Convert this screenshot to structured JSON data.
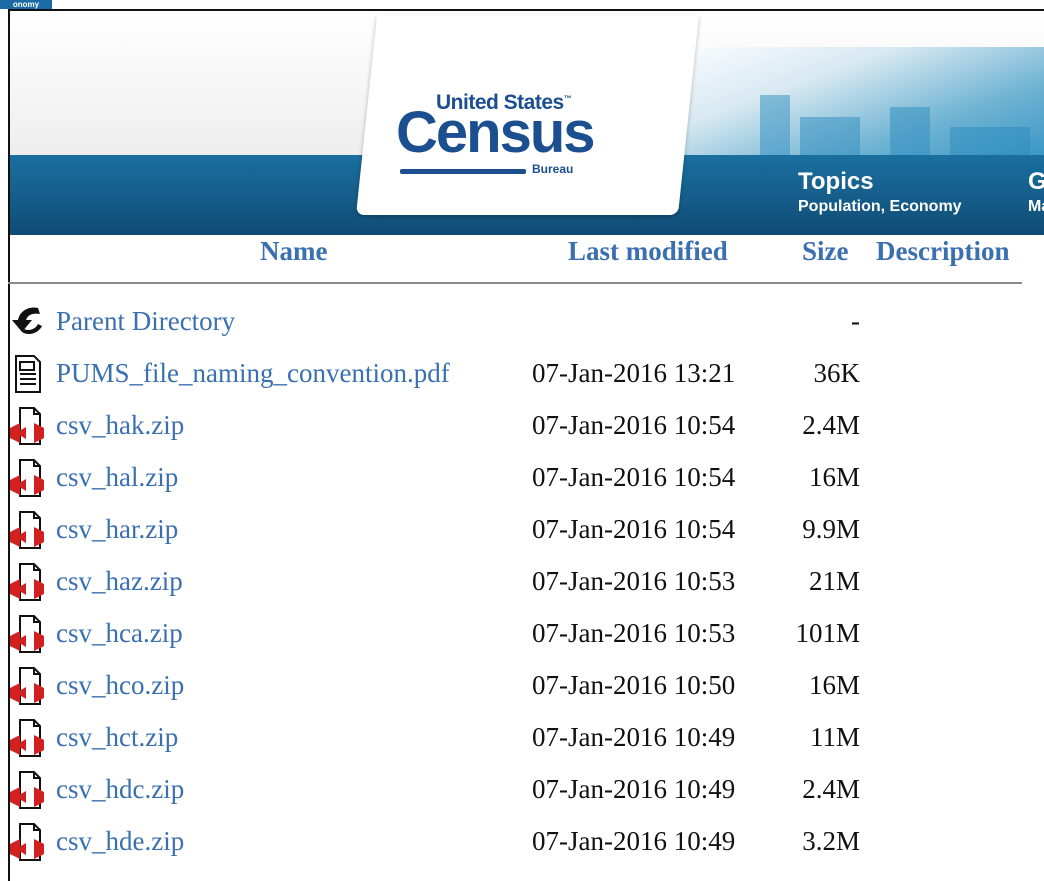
{
  "corner_tab": "onomy",
  "banner": {
    "logo_united": "United States",
    "logo_census": "Census",
    "logo_bureau": "Bureau",
    "nav": [
      {
        "title": "Topics",
        "subtitle": "Population, Economy"
      },
      {
        "title": "G",
        "subtitle": "Ma"
      }
    ],
    "colors": {
      "blue_band": "#155d89",
      "logo": "#1b4f8f"
    }
  },
  "table": {
    "headers": {
      "name": "Name",
      "last_modified": "Last modified",
      "size": "Size",
      "description": "Description"
    },
    "rows": [
      {
        "icon": "back-arrow-icon",
        "name": "Parent Directory",
        "modified": "",
        "size": "-"
      },
      {
        "icon": "text-document-icon",
        "name": "PUMS_file_naming_convention.pdf",
        "modified": "07-Jan-2016 13:21",
        "size": "36K"
      },
      {
        "icon": "compressed-file-icon",
        "name": "csv_hak.zip",
        "modified": "07-Jan-2016 10:54",
        "size": "2.4M"
      },
      {
        "icon": "compressed-file-icon",
        "name": "csv_hal.zip",
        "modified": "07-Jan-2016 10:54",
        "size": "16M"
      },
      {
        "icon": "compressed-file-icon",
        "name": "csv_har.zip",
        "modified": "07-Jan-2016 10:54",
        "size": "9.9M"
      },
      {
        "icon": "compressed-file-icon",
        "name": "csv_haz.zip",
        "modified": "07-Jan-2016 10:53",
        "size": "21M"
      },
      {
        "icon": "compressed-file-icon",
        "name": "csv_hca.zip",
        "modified": "07-Jan-2016 10:53",
        "size": "101M"
      },
      {
        "icon": "compressed-file-icon",
        "name": "csv_hco.zip",
        "modified": "07-Jan-2016 10:50",
        "size": "16M"
      },
      {
        "icon": "compressed-file-icon",
        "name": "csv_hct.zip",
        "modified": "07-Jan-2016 10:49",
        "size": "11M"
      },
      {
        "icon": "compressed-file-icon",
        "name": "csv_hdc.zip",
        "modified": "07-Jan-2016 10:49",
        "size": "2.4M"
      },
      {
        "icon": "compressed-file-icon",
        "name": "csv_hde.zip",
        "modified": "07-Jan-2016 10:49",
        "size": "3.2M"
      }
    ],
    "colors": {
      "link": "#3a6fb0",
      "text": "#111111"
    }
  }
}
